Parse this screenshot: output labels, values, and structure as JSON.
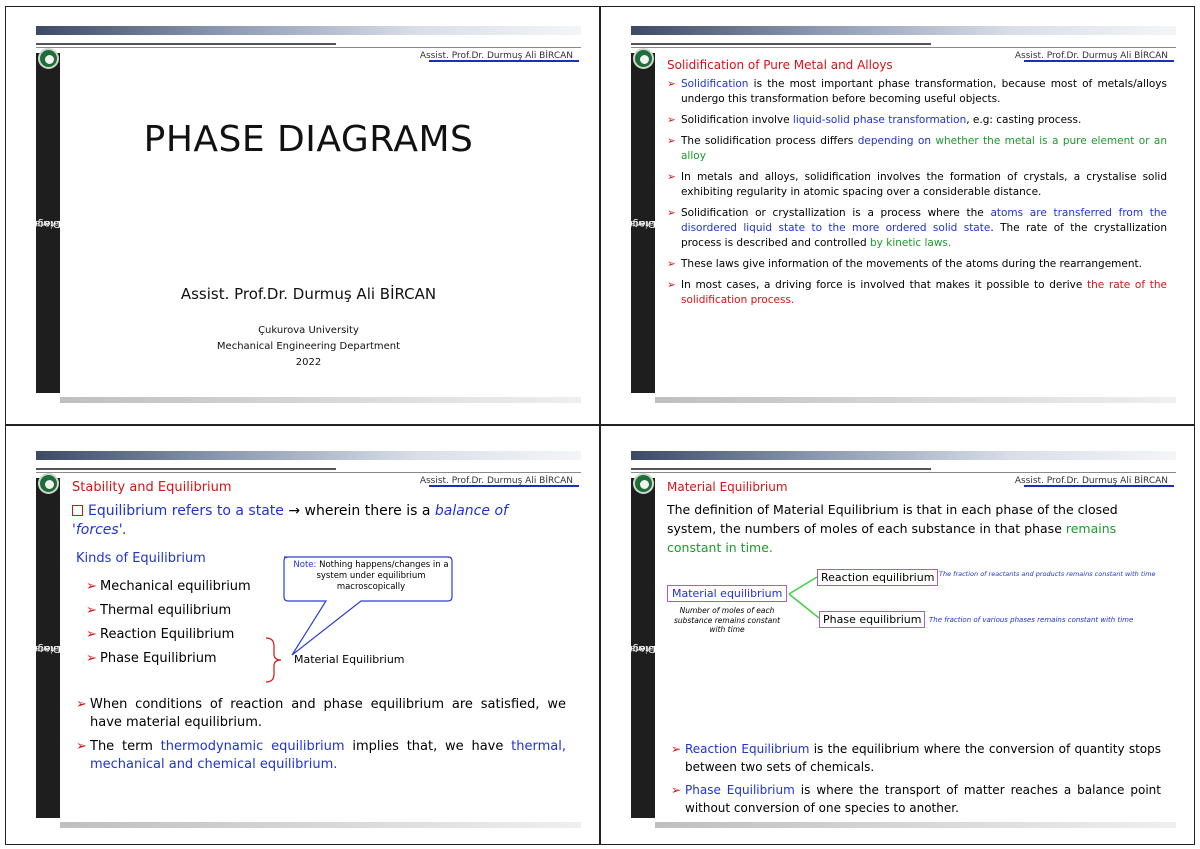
{
  "common": {
    "author_short": "Assist. Prof.Dr. Durmuş Ali BİRCAN",
    "sidebar_line1": "ME 208 Materials Science II",
    "sidebar_line2": "Phase Diagrams",
    "colors": {
      "red": "#d41414",
      "blue": "#1e33d6",
      "green": "#1c9a2b",
      "purple": "#b25ac8"
    }
  },
  "slide1": {
    "title": "PHASE DIAGRAMS",
    "author": "Assist. Prof.Dr. Durmuş Ali BİRCAN",
    "university": "Çukurova University",
    "department": "Mechanical Engineering Department",
    "year": "2022"
  },
  "slide2": {
    "heading": "Solidification of Pure Metal and Alloys",
    "b1_hl": "Solidification",
    "b1_rest": " is the most important phase transformation, because most of metals/alloys undergo this transformation before becoming useful objects.",
    "b2_pre": "Solidification involve ",
    "b2_hl": "liquid-solid phase transformation",
    "b2_rest": ", e.g: casting process.",
    "b3_pre": "The solidification process differs ",
    "b3_hl": "depending on",
    "b3_green": " whether the metal is a pure element or an alloy",
    "b4": "In metals and alloys, solidification involves the formation of crystals, a crystalise solid exhibiting regularity in atomic spacing over a considerable distance.",
    "b5_pre": "Solidification or crystallization is a process where the ",
    "b5_hl": "atoms are transferred from the disordered liquid state to the more ordered solid state",
    "b5_mid": ". The rate of the crystallization process is described and controlled ",
    "b5_green": "by kinetic laws.",
    "b6": "These laws give information of the movements of the atoms during the rearrangement.",
    "b7_pre": "In most cases, a driving force is involved that makes it possible to derive ",
    "b7_red": "the rate of the solidification process."
  },
  "slide3": {
    "heading": "Stability and Equilibrium",
    "intro_blue": "Equilibrium refers to a state",
    "intro_arrow": " → wherein there is a ",
    "intro_ital": "balance of 'forces'.",
    "kinds": "Kinds of Equilibrium",
    "items": [
      "Mechanical equilibrium",
      "Thermal equilibrium",
      "Reaction Equilibrium",
      "Phase Equilibrium"
    ],
    "note_label": "Note:",
    "note_text": " Nothing happens/changes in a system under equilibrium macroscopically",
    "material_eq": "Material Equilibrium",
    "b1": "When conditions of reaction and phase equilibrium are satisfied, we have material equilibrium.",
    "b2_pre": "The term ",
    "b2_hl": "thermodynamic equilibrium",
    "b2_mid": " implies that, we have ",
    "b2_hl2": "thermal, mechanical and chemical equilibrium."
  },
  "slide4": {
    "heading": "Material Equilibrium",
    "def_pre": "The definition of Material Equilibrium is that in each phase of the closed system, the numbers of moles of each substance in that phase ",
    "def_green": "remains constant in time.",
    "box_material": "Material equilibrium",
    "box_reaction": "Reaction equilibrium",
    "box_phase": "Phase equilibrium",
    "note_moles": "Number of moles of each substance remains constant with time",
    "note_reaction": "The fraction of reactants and products remains constant with time",
    "note_phase": "The fraction of various phases remains constant with time",
    "b1_hl": "Reaction Equilibrium",
    "b1_rest": " is the equilibrium where the conversion of quantity stops between two sets of chemicals.",
    "b2_hl": "Phase Equilibrium",
    "b2_rest": " is where the transport of matter reaches a balance point without conversion of one species to another."
  }
}
